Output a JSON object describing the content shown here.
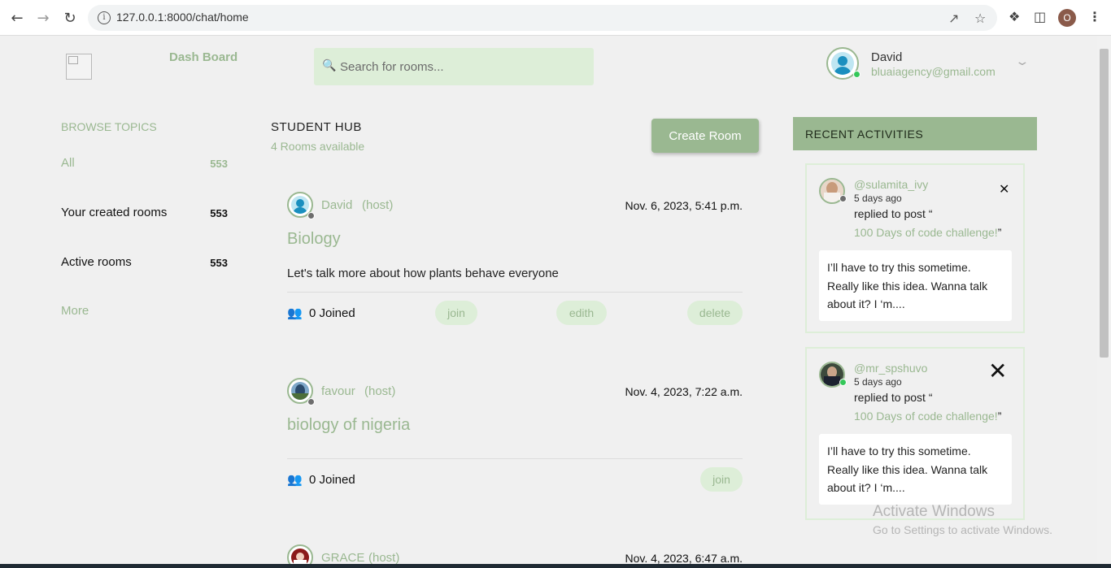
{
  "browser": {
    "url": "127.0.0.1:8000/chat/home",
    "profile_initial": "O"
  },
  "header": {
    "dash_title": "Dash Board",
    "search_placeholder": "Search for rooms...",
    "user_name": "David",
    "user_email": "bluaiagency@gmail.com"
  },
  "sidebar": {
    "title": "BROWSE TOPICS",
    "topics": [
      {
        "label": "All",
        "count": "553"
      },
      {
        "label": "Your created rooms",
        "count": "553"
      },
      {
        "label": "Active rooms",
        "count": "553"
      }
    ],
    "more": "More"
  },
  "feed": {
    "title": "STUDENT HUB",
    "count_text": "4 Rooms available",
    "create_label": "Create Room",
    "rooms": [
      {
        "host": "David",
        "host_tag": "(host)",
        "date": "Nov. 6, 2023, 5:41 p.m.",
        "title": "Biology",
        "description": "Let's talk more about how plants behave everyone",
        "joined": "0 Joined",
        "join": "join",
        "edit": "edith",
        "delete": "delete"
      },
      {
        "host": "favour",
        "host_tag": "(host)",
        "date": "Nov. 4, 2023, 7:22 a.m.",
        "title": "biology of nigeria",
        "joined": "0 Joined",
        "join": "join"
      },
      {
        "host": "GRACE",
        "host_tag": "(host)",
        "date": "Nov. 4, 2023, 6:47 a.m."
      }
    ]
  },
  "activities": {
    "title": "RECENT ACTIVITIES",
    "items": [
      {
        "handle": "@sulamita_ivy",
        "ago": "5 days ago",
        "replied": "replied to post “",
        "post": "100 Days of code challenge!",
        "post_close": "”",
        "message": "I’ll have to try this sometime. Really like this idea. Wanna talk about it? I ‘m...."
      },
      {
        "handle": "@mr_spshuvo",
        "ago": "5 days ago",
        "replied": "replied to post “",
        "post": "100 Days of code challenge!",
        "post_close": "”",
        "message": "I’ll have to try this sometime. Really like this idea. Wanna talk about it? I ‘m...."
      }
    ]
  },
  "watermark": {
    "line1": "Activate Windows",
    "line2": "Go to Settings to activate Windows."
  },
  "colors": {
    "accent": "#9ab891",
    "accent_light": "#ddeed8",
    "background": "#f0f0f0"
  },
  "icons": [
    "back-arrow-icon",
    "forward-arrow-icon",
    "reload-icon",
    "info-icon",
    "share-icon",
    "star-icon",
    "puzzle-icon",
    "sidepanel-icon",
    "kebab-menu-icon",
    "search-icon",
    "chevron-down-icon",
    "people-icon",
    "close-icon"
  ]
}
